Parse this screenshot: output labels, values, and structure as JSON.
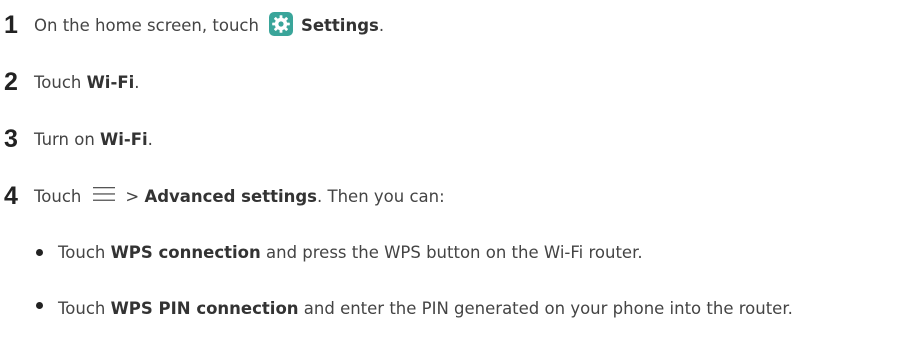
{
  "steps": [
    {
      "num": "1",
      "pre": "On the home screen, touch",
      "icon": "settings-gear-icon",
      "bold": "Settings",
      "post": "."
    },
    {
      "num": "2",
      "pre": "Touch",
      "bold": "Wi-Fi",
      "post": "."
    },
    {
      "num": "3",
      "pre": "Turn on",
      "bold": "Wi-Fi",
      "post": "."
    },
    {
      "num": "4",
      "pre": "Touch",
      "icon": "menu-icon",
      "gt": ">",
      "bold": "Advanced settings",
      "post": ". Then you can:"
    }
  ],
  "bullets": [
    {
      "pre": "Touch",
      "bold": "WPS connection",
      "post": "and press the WPS button on the Wi-Fi router."
    },
    {
      "pre": "Touch",
      "bold": "WPS PIN connection",
      "post": "and enter the PIN generated on your phone into the router."
    }
  ],
  "colors": {
    "text": "#444444",
    "number": "#222222",
    "settings_icon_bg": "#3aa59a",
    "menu_icon": "#555555"
  }
}
